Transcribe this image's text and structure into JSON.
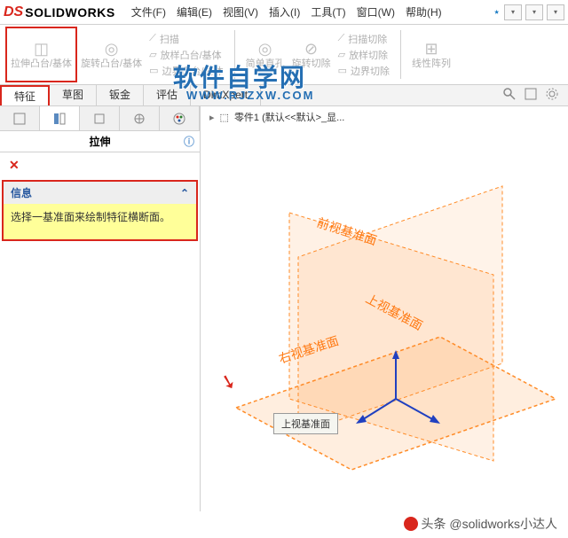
{
  "app": {
    "logo_mark": "DS",
    "logo_text": "SOLIDWORKS"
  },
  "menubar": {
    "items": [
      "文件(F)",
      "编辑(E)",
      "视图(V)",
      "插入(I)",
      "工具(T)",
      "窗口(W)",
      "帮助(H)"
    ],
    "pin": "⋆"
  },
  "ribbon": {
    "extrude": "拉伸凸台/基体",
    "revolve": "旋转凸台/基体",
    "sweep": "扫描",
    "loft": "放样凸台/基体",
    "boundary": "边界凸台/基体",
    "hole": "简单直孔",
    "revolvecut": "旋转切除",
    "sweepcut": "扫描切除",
    "loftcut": "放样切除",
    "boundarycut": "边界切除",
    "pattern": "线性阵列"
  },
  "watermark": {
    "title": "软件自学网",
    "url": "WWW.RJZXW.COM"
  },
  "tabs": [
    "特征",
    "草图",
    "钣金",
    "评估",
    "DimXpert"
  ],
  "sidebar": {
    "feature_title": "拉伸",
    "info_label": "信息",
    "info_text": "选择一基准面来绘制特征横断面。"
  },
  "breadcrumb": {
    "part": "零件1 (默认<<默认>_显..."
  },
  "planes": {
    "front": "前视基准面",
    "top": "上视基准面",
    "right": "右视基准面",
    "tooltip": "上视基准面"
  },
  "footer": {
    "text": "头条 @solidworks小达人"
  }
}
